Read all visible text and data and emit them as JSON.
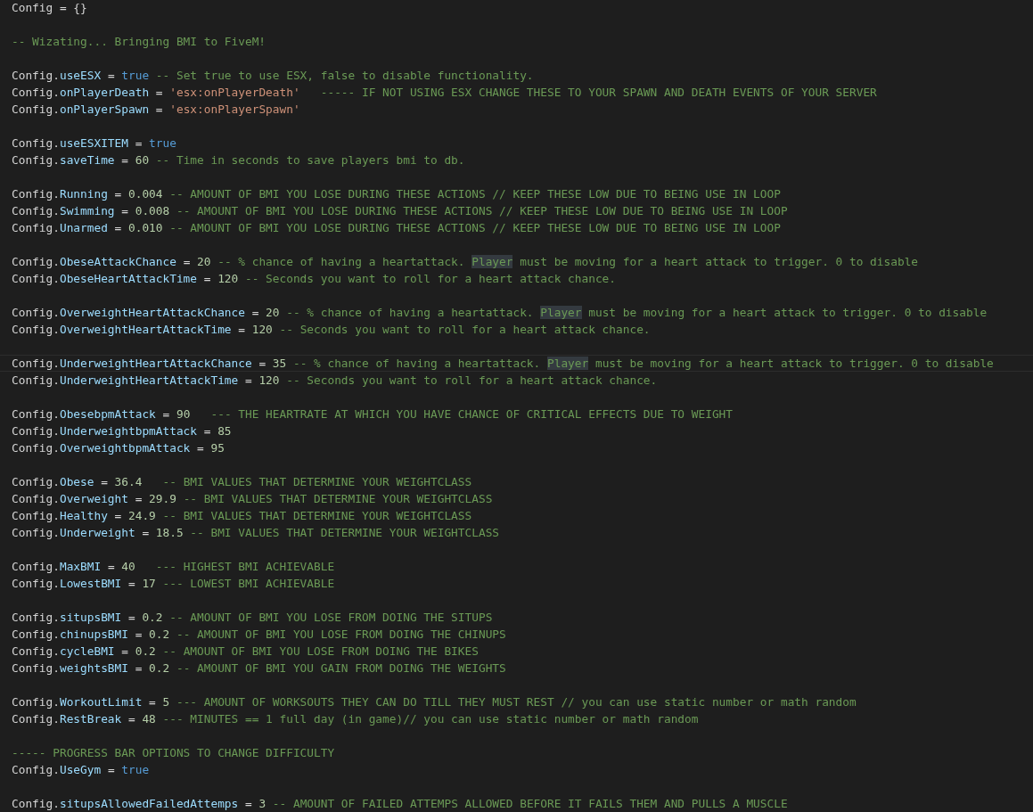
{
  "editor": {
    "lines": [
      {
        "current": false,
        "tokens": [
          {
            "kind": "plain",
            "text": "Config = {}"
          }
        ]
      },
      {
        "current": false
      },
      {
        "current": false,
        "tokens": [
          {
            "kind": "comment",
            "text": "-- Wizating... Bringing BMI to FiveM!"
          }
        ]
      },
      {
        "current": false
      },
      {
        "current": false,
        "tokens": [
          {
            "kind": "plain",
            "text": "Config."
          },
          {
            "kind": "property",
            "text": "useESX"
          },
          {
            "kind": "plain",
            "text": " = "
          },
          {
            "kind": "keyword",
            "text": "true"
          },
          {
            "kind": "comment",
            "text": " -- Set true to use ESX, false to disable functionality."
          }
        ]
      },
      {
        "current": false,
        "tokens": [
          {
            "kind": "plain",
            "text": "Config."
          },
          {
            "kind": "property",
            "text": "onPlayerDeath"
          },
          {
            "kind": "plain",
            "text": " = "
          },
          {
            "kind": "string",
            "text": "'esx:onPlayerDeath'"
          },
          {
            "kind": "comment",
            "text": "   ----- IF NOT USING ESX CHANGE THESE TO YOUR SPAWN AND DEATH EVENTS OF YOUR SERVER"
          }
        ]
      },
      {
        "current": false,
        "tokens": [
          {
            "kind": "plain",
            "text": "Config."
          },
          {
            "kind": "property",
            "text": "onPlayerSpawn"
          },
          {
            "kind": "plain",
            "text": " = "
          },
          {
            "kind": "string",
            "text": "'esx:onPlayerSpawn'"
          }
        ]
      },
      {
        "current": false
      },
      {
        "current": false,
        "tokens": [
          {
            "kind": "plain",
            "text": "Config."
          },
          {
            "kind": "property",
            "text": "useESXITEM"
          },
          {
            "kind": "plain",
            "text": " = "
          },
          {
            "kind": "keyword",
            "text": "true"
          }
        ]
      },
      {
        "current": false,
        "tokens": [
          {
            "kind": "plain",
            "text": "Config."
          },
          {
            "kind": "property",
            "text": "saveTime"
          },
          {
            "kind": "plain",
            "text": " = "
          },
          {
            "kind": "number",
            "text": "60"
          },
          {
            "kind": "comment",
            "text": " -- Time in seconds to save players bmi to db."
          }
        ]
      },
      {
        "current": false
      },
      {
        "current": false,
        "tokens": [
          {
            "kind": "plain",
            "text": "Config."
          },
          {
            "kind": "property",
            "text": "Running"
          },
          {
            "kind": "plain",
            "text": " = "
          },
          {
            "kind": "number",
            "text": "0.004"
          },
          {
            "kind": "comment",
            "text": " -- AMOUNT OF BMI YOU LOSE DURING THESE ACTIONS // KEEP THESE LOW DUE TO BEING USE IN LOOP"
          }
        ]
      },
      {
        "current": false,
        "tokens": [
          {
            "kind": "plain",
            "text": "Config."
          },
          {
            "kind": "property",
            "text": "Swimming"
          },
          {
            "kind": "plain",
            "text": " = "
          },
          {
            "kind": "number",
            "text": "0.008"
          },
          {
            "kind": "comment",
            "text": " -- AMOUNT OF BMI YOU LOSE DURING THESE ACTIONS // KEEP THESE LOW DUE TO BEING USE IN LOOP"
          }
        ]
      },
      {
        "current": false,
        "tokens": [
          {
            "kind": "plain",
            "text": "Config."
          },
          {
            "kind": "property",
            "text": "Unarmed"
          },
          {
            "kind": "plain",
            "text": " = "
          },
          {
            "kind": "number",
            "text": "0.010"
          },
          {
            "kind": "comment",
            "text": " -- AMOUNT OF BMI YOU LOSE DURING THESE ACTIONS // KEEP THESE LOW DUE TO BEING USE IN LOOP"
          }
        ]
      },
      {
        "current": false
      },
      {
        "current": false,
        "tokens": [
          {
            "kind": "plain",
            "text": "Config."
          },
          {
            "kind": "property",
            "text": "ObeseAttackChance"
          },
          {
            "kind": "plain",
            "text": " = "
          },
          {
            "kind": "number",
            "text": "20"
          },
          {
            "kind": "comment",
            "text": " -- % chance of having a heartattack. "
          },
          {
            "kind": "match",
            "text": "Player"
          },
          {
            "kind": "comment",
            "text": " must be moving for a heart attack to trigger. 0 to disable"
          }
        ]
      },
      {
        "current": false,
        "tokens": [
          {
            "kind": "plain",
            "text": "Config."
          },
          {
            "kind": "property",
            "text": "ObeseHeartAttackTime"
          },
          {
            "kind": "plain",
            "text": " = "
          },
          {
            "kind": "number",
            "text": "120"
          },
          {
            "kind": "comment",
            "text": " -- Seconds you want to roll for a heart attack chance."
          }
        ]
      },
      {
        "current": false
      },
      {
        "current": false,
        "tokens": [
          {
            "kind": "plain",
            "text": "Config."
          },
          {
            "kind": "property",
            "text": "OverweightHeartAttackChance"
          },
          {
            "kind": "plain",
            "text": " = "
          },
          {
            "kind": "number",
            "text": "20"
          },
          {
            "kind": "comment",
            "text": " -- % chance of having a heartattack. "
          },
          {
            "kind": "match",
            "text": "Player"
          },
          {
            "kind": "comment",
            "text": " must be moving for a heart attack to trigger. 0 to disable"
          }
        ]
      },
      {
        "current": false,
        "tokens": [
          {
            "kind": "plain",
            "text": "Config."
          },
          {
            "kind": "property",
            "text": "OverweightHeartAttackTime"
          },
          {
            "kind": "plain",
            "text": " = "
          },
          {
            "kind": "number",
            "text": "120"
          },
          {
            "kind": "comment",
            "text": " -- Seconds you want to roll for a heart attack chance."
          }
        ]
      },
      {
        "current": false
      },
      {
        "current": true,
        "tokens": [
          {
            "kind": "plain",
            "text": "Config."
          },
          {
            "kind": "property",
            "text": "UnderweightHeartAttackChance"
          },
          {
            "kind": "plain",
            "text": " = "
          },
          {
            "kind": "number",
            "text": "35"
          },
          {
            "kind": "comment",
            "text": " -- % chance of having a heartattack. "
          },
          {
            "kind": "match",
            "text": "Player"
          },
          {
            "kind": "comment",
            "text": " must be moving for a heart attack to trigger. 0 to disable"
          }
        ]
      },
      {
        "current": false,
        "tokens": [
          {
            "kind": "plain",
            "text": "Config."
          },
          {
            "kind": "property",
            "text": "UnderweightHeartAttackTime"
          },
          {
            "kind": "plain",
            "text": " = "
          },
          {
            "kind": "number",
            "text": "120"
          },
          {
            "kind": "comment",
            "text": " -- Seconds you want to roll for a heart attack chance."
          }
        ]
      },
      {
        "current": false
      },
      {
        "current": false,
        "tokens": [
          {
            "kind": "plain",
            "text": "Config."
          },
          {
            "kind": "property",
            "text": "ObesebpmAttack"
          },
          {
            "kind": "plain",
            "text": " = "
          },
          {
            "kind": "number",
            "text": "90"
          },
          {
            "kind": "comment",
            "text": "   --- THE HEARTRATE AT WHICH YOU HAVE CHANCE OF CRITICAL EFFECTS DUE TO WEIGHT"
          }
        ]
      },
      {
        "current": false,
        "tokens": [
          {
            "kind": "plain",
            "text": "Config."
          },
          {
            "kind": "property",
            "text": "UnderweightbpmAttack"
          },
          {
            "kind": "plain",
            "text": " = "
          },
          {
            "kind": "number",
            "text": "85"
          }
        ]
      },
      {
        "current": false,
        "tokens": [
          {
            "kind": "plain",
            "text": "Config."
          },
          {
            "kind": "property",
            "text": "OverweightbpmAttack"
          },
          {
            "kind": "plain",
            "text": " = "
          },
          {
            "kind": "number",
            "text": "95"
          }
        ]
      },
      {
        "current": false
      },
      {
        "current": false,
        "tokens": [
          {
            "kind": "plain",
            "text": "Config."
          },
          {
            "kind": "property",
            "text": "Obese"
          },
          {
            "kind": "plain",
            "text": " = "
          },
          {
            "kind": "number",
            "text": "36.4"
          },
          {
            "kind": "comment",
            "text": "   -- BMI VALUES THAT DETERMINE YOUR WEIGHTCLASS"
          }
        ]
      },
      {
        "current": false,
        "tokens": [
          {
            "kind": "plain",
            "text": "Config."
          },
          {
            "kind": "property",
            "text": "Overweight"
          },
          {
            "kind": "plain",
            "text": " = "
          },
          {
            "kind": "number",
            "text": "29.9"
          },
          {
            "kind": "comment",
            "text": " -- BMI VALUES THAT DETERMINE YOUR WEIGHTCLASS"
          }
        ]
      },
      {
        "current": false,
        "tokens": [
          {
            "kind": "plain",
            "text": "Config."
          },
          {
            "kind": "property",
            "text": "Healthy"
          },
          {
            "kind": "plain",
            "text": " = "
          },
          {
            "kind": "number",
            "text": "24.9"
          },
          {
            "kind": "comment",
            "text": " -- BMI VALUES THAT DETERMINE YOUR WEIGHTCLASS"
          }
        ]
      },
      {
        "current": false,
        "tokens": [
          {
            "kind": "plain",
            "text": "Config."
          },
          {
            "kind": "property",
            "text": "Underweight"
          },
          {
            "kind": "plain",
            "text": " = "
          },
          {
            "kind": "number",
            "text": "18.5"
          },
          {
            "kind": "comment",
            "text": " -- BMI VALUES THAT DETERMINE YOUR WEIGHTCLASS"
          }
        ]
      },
      {
        "current": false
      },
      {
        "current": false,
        "tokens": [
          {
            "kind": "plain",
            "text": "Config."
          },
          {
            "kind": "property",
            "text": "MaxBMI"
          },
          {
            "kind": "plain",
            "text": " = "
          },
          {
            "kind": "number",
            "text": "40"
          },
          {
            "kind": "comment",
            "text": "   --- HIGHEST BMI ACHIEVABLE"
          }
        ]
      },
      {
        "current": false,
        "tokens": [
          {
            "kind": "plain",
            "text": "Config."
          },
          {
            "kind": "property",
            "text": "LowestBMI"
          },
          {
            "kind": "plain",
            "text": " = "
          },
          {
            "kind": "number",
            "text": "17"
          },
          {
            "kind": "comment",
            "text": " --- LOWEST BMI ACHIEVABLE"
          }
        ]
      },
      {
        "current": false
      },
      {
        "current": false,
        "tokens": [
          {
            "kind": "plain",
            "text": "Config."
          },
          {
            "kind": "property",
            "text": "situpsBMI"
          },
          {
            "kind": "plain",
            "text": " = "
          },
          {
            "kind": "number",
            "text": "0.2"
          },
          {
            "kind": "comment",
            "text": " -- AMOUNT OF BMI YOU LOSE FROM DOING THE SITUPS"
          }
        ]
      },
      {
        "current": false,
        "tokens": [
          {
            "kind": "plain",
            "text": "Config."
          },
          {
            "kind": "property",
            "text": "chinupsBMI"
          },
          {
            "kind": "plain",
            "text": " = "
          },
          {
            "kind": "number",
            "text": "0.2"
          },
          {
            "kind": "comment",
            "text": " -- AMOUNT OF BMI YOU LOSE FROM DOING THE CHINUPS"
          }
        ]
      },
      {
        "current": false,
        "tokens": [
          {
            "kind": "plain",
            "text": "Config."
          },
          {
            "kind": "property",
            "text": "cycleBMI"
          },
          {
            "kind": "plain",
            "text": " = "
          },
          {
            "kind": "number",
            "text": "0.2"
          },
          {
            "kind": "comment",
            "text": " -- AMOUNT OF BMI YOU LOSE FROM DOING THE BIKES"
          }
        ]
      },
      {
        "current": false,
        "tokens": [
          {
            "kind": "plain",
            "text": "Config."
          },
          {
            "kind": "property",
            "text": "weightsBMI"
          },
          {
            "kind": "plain",
            "text": " = "
          },
          {
            "kind": "number",
            "text": "0.2"
          },
          {
            "kind": "comment",
            "text": " -- AMOUNT OF BMI YOU GAIN FROM DOING THE WEIGHTS"
          }
        ]
      },
      {
        "current": false
      },
      {
        "current": false,
        "tokens": [
          {
            "kind": "plain",
            "text": "Config."
          },
          {
            "kind": "property",
            "text": "WorkoutLimit"
          },
          {
            "kind": "plain",
            "text": " = "
          },
          {
            "kind": "number",
            "text": "5"
          },
          {
            "kind": "comment",
            "text": " --- AMOUNT OF WORKSOUTS THEY CAN DO TILL THEY MUST REST // you can use static number or math random"
          }
        ]
      },
      {
        "current": false,
        "tokens": [
          {
            "kind": "plain",
            "text": "Config."
          },
          {
            "kind": "property",
            "text": "RestBreak"
          },
          {
            "kind": "plain",
            "text": " = "
          },
          {
            "kind": "number",
            "text": "48"
          },
          {
            "kind": "comment",
            "text": " --- MINUTES == 1 full day (in game)// you can use static number or math random"
          }
        ]
      },
      {
        "current": false
      },
      {
        "current": false,
        "tokens": [
          {
            "kind": "comment",
            "text": "----- PROGRESS BAR OPTIONS TO CHANGE DIFFICULTY"
          }
        ]
      },
      {
        "current": false,
        "tokens": [
          {
            "kind": "plain",
            "text": "Config."
          },
          {
            "kind": "property",
            "text": "UseGym"
          },
          {
            "kind": "plain",
            "text": " = "
          },
          {
            "kind": "keyword",
            "text": "true"
          }
        ]
      },
      {
        "current": false
      },
      {
        "current": false,
        "tokens": [
          {
            "kind": "plain",
            "text": "Config."
          },
          {
            "kind": "property",
            "text": "situpsAllowedFailedAttemps"
          },
          {
            "kind": "plain",
            "text": " = "
          },
          {
            "kind": "number",
            "text": "3"
          },
          {
            "kind": "comment",
            "text": " -- AMOUNT OF FAILED ATTEMPS ALLOWED BEFORE IT FAILS THEM AND PULLS A MUSCLE"
          }
        ]
      }
    ]
  }
}
